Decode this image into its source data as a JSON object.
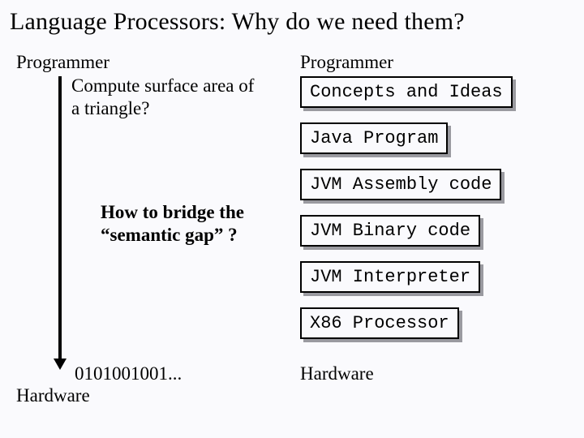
{
  "title": "Language Processors: Why do we need them?",
  "left": {
    "programmer": "Programmer",
    "question_l1": "Compute surface area of",
    "question_l2": "a triangle?",
    "bridge_l1": "How to bridge the",
    "bridge_l2": "“semantic gap” ?",
    "binary": "0101001001...",
    "hardware": "Hardware"
  },
  "right": {
    "programmer": "Programmer",
    "boxes": [
      "Concepts and Ideas",
      "Java Program",
      "JVM Assembly code",
      "JVM Binary code",
      "JVM Interpreter",
      "X86 Processor"
    ],
    "hardware": "Hardware"
  }
}
